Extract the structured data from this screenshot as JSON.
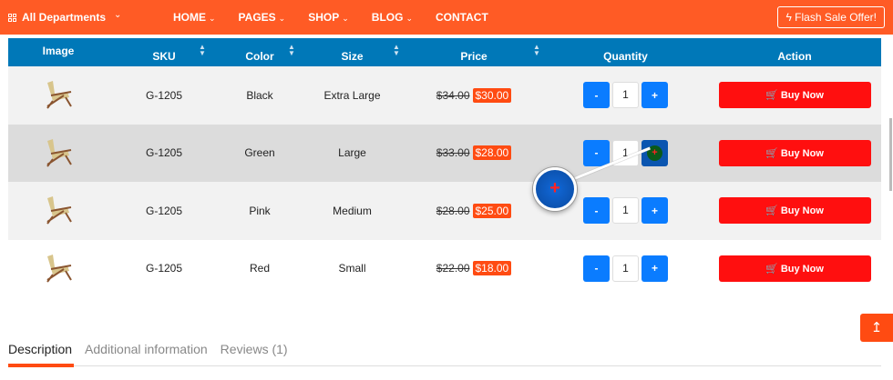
{
  "topbar": {
    "departments": "All Departments",
    "nav": [
      {
        "label": "HOME",
        "dropdown": true
      },
      {
        "label": "PAGES",
        "dropdown": true
      },
      {
        "label": "SHOP",
        "dropdown": true
      },
      {
        "label": "BLOG",
        "dropdown": true
      },
      {
        "label": "CONTACT",
        "dropdown": false
      }
    ],
    "flash": "Flash Sale Offer!"
  },
  "table": {
    "headers": [
      "Image",
      "SKU",
      "Color",
      "Size",
      "Price",
      "Quantity",
      "Action"
    ],
    "rows": [
      {
        "sku": "G-1205",
        "color": "Black",
        "size": "Extra Large",
        "old_price": "$34.00",
        "price": "$30.00",
        "qty": "1"
      },
      {
        "sku": "G-1205",
        "color": "Green",
        "size": "Large",
        "old_price": "$33.00",
        "price": "$28.00",
        "qty": "1"
      },
      {
        "sku": "G-1205",
        "color": "Pink",
        "size": "Medium",
        "old_price": "$28.00",
        "price": "$25.00",
        "qty": "1"
      },
      {
        "sku": "G-1205",
        "color": "Red",
        "size": "Small",
        "old_price": "$22.00",
        "price": "$18.00",
        "qty": "1"
      }
    ],
    "minus": "-",
    "plus": "+",
    "buy": "Buy Now"
  },
  "tabs": [
    "Description",
    "Additional information",
    "Reviews (1)"
  ],
  "colors": {
    "brand": "#ff5b25",
    "header": "#0078b8",
    "buy": "#ff0f0f",
    "qty": "#0a7cff"
  }
}
